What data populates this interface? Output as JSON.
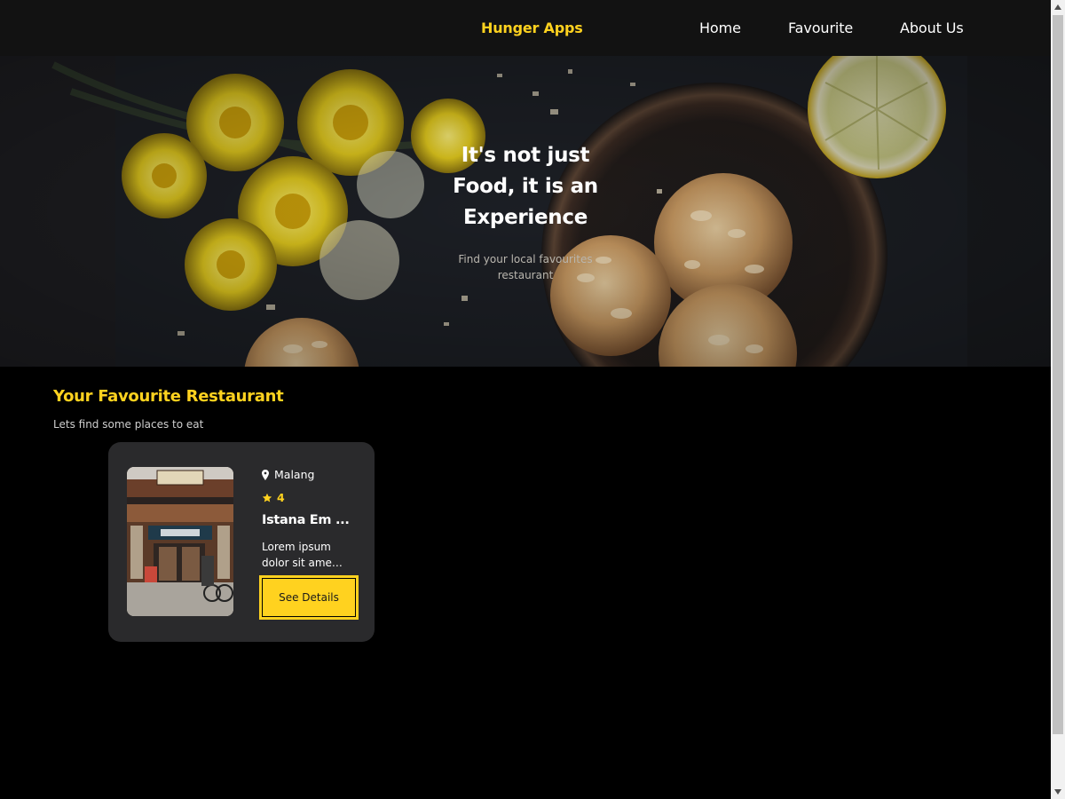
{
  "header": {
    "brand": "Hunger Apps",
    "nav": [
      {
        "label": "Home"
      },
      {
        "label": "Favourite"
      },
      {
        "label": "About Us"
      }
    ]
  },
  "hero": {
    "title_lines": [
      "It's not just",
      "Food, it is an",
      "Experience"
    ],
    "subtitle_lines": [
      "Find your local favourites",
      "restaurant"
    ]
  },
  "favourites": {
    "title": "Your Favourite Restaurant",
    "subtitle": "Lets find some places to eat",
    "cards": [
      {
        "city": "Malang",
        "rating": "4",
        "name": "Istana Em ...",
        "description_lines": [
          "Lorem ipsum",
          "dolor sit ame ..."
        ],
        "button_label": "See Details"
      }
    ]
  },
  "colors": {
    "accent": "#ffd21f",
    "header_bg": "#121212",
    "card_bg": "#2a2a2c",
    "page_bg": "#000000"
  },
  "icons": [
    "map-pin-icon",
    "star-icon",
    "scroll-up-arrow-icon",
    "scroll-down-arrow-icon"
  ]
}
